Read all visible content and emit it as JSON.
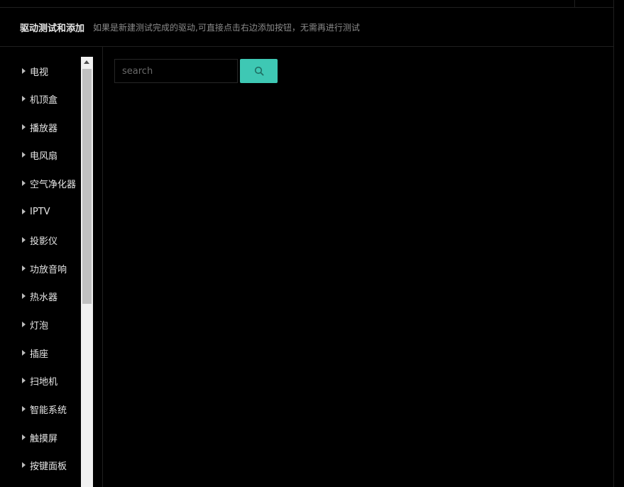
{
  "header": {
    "title": "驱动测试和添加",
    "hint": "如果是新建测试完成的驱动,可直接点击右边添加按钮，无需再进行测试"
  },
  "sidebar": {
    "items": [
      {
        "label": "电视"
      },
      {
        "label": "机顶盒"
      },
      {
        "label": "播放器"
      },
      {
        "label": "电风扇"
      },
      {
        "label": "空气净化器"
      },
      {
        "label": "IPTV"
      },
      {
        "label": "投影仪"
      },
      {
        "label": "功放音响"
      },
      {
        "label": "热水器"
      },
      {
        "label": "灯泡"
      },
      {
        "label": "插座"
      },
      {
        "label": "扫地机"
      },
      {
        "label": "智能系统"
      },
      {
        "label": "触摸屏"
      },
      {
        "label": "按键面板"
      }
    ]
  },
  "search": {
    "placeholder": "search",
    "value": "",
    "button_icon": "search-icon"
  },
  "colors": {
    "background": "#000000",
    "accent": "#3ec8b4",
    "text": "#e6e6e6",
    "hint_text": "#8a8a8a"
  }
}
